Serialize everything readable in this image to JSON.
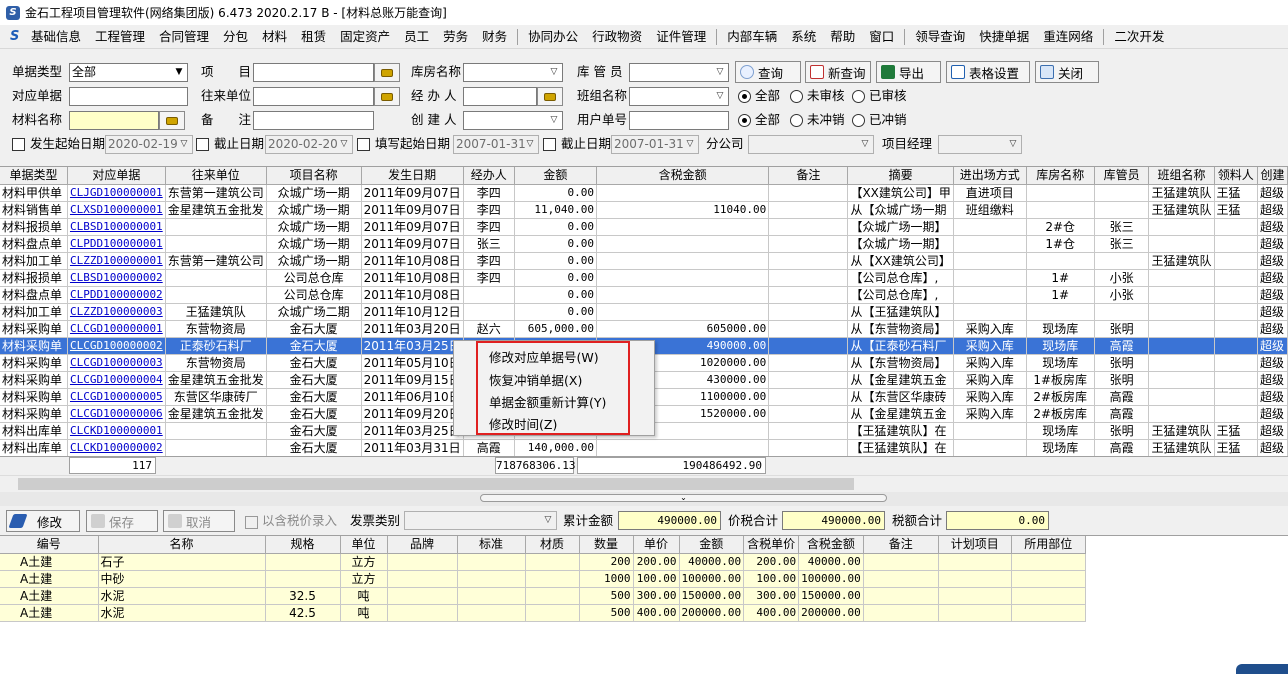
{
  "window": {
    "title": "金石工程项目管理软件(网络集团版) 6.473  2020.2.17 B - [材料总账万能查询]"
  },
  "menu": [
    "基础信息",
    "工程管理",
    "合同管理",
    "分包",
    "材料",
    "租赁",
    "固定资产",
    "员工",
    "劳务",
    "财务",
    "协同办公",
    "行政物资",
    "证件管理",
    "内部车辆",
    "系统",
    "帮助",
    "窗口",
    "领导查询",
    "快捷单据",
    "重连网络",
    "二次开发"
  ],
  "filter": {
    "doc_type_label": "单据类型",
    "doc_type_value": "全部",
    "project_label": "项　　目",
    "warehouse_label": "库房名称",
    "keeper_label": "库 管 员",
    "related_doc_label": "对应单据",
    "partner_label": "往来单位",
    "handler_label": "经 办 人",
    "team_label": "班组名称",
    "material_label": "材料名称",
    "remark_label": "备　　注",
    "creator_label": "创 建 人",
    "user_doc_label": "用户单号",
    "audit_all": "全部",
    "audit_no": "未审核",
    "audit_yes": "已审核",
    "offset_all": "全部",
    "offset_no": "未冲销",
    "offset_yes": "已冲销",
    "start_date_label": "发生起始日期",
    "start_date": "2020-02-19",
    "end_date_label": "截止日期",
    "end_date": "2020-02-20",
    "fill_start_label": "填写起始日期",
    "fill_start": "2007-01-31",
    "fill_end_label": "截止日期",
    "fill_end": "2007-01-31",
    "branch_label": "分公司",
    "pm_label": "项目经理"
  },
  "buttons": {
    "query": "查询",
    "new_query": "新查询",
    "export": "导出",
    "table_settings": "表格设置",
    "close": "关闭"
  },
  "grid": {
    "columns": [
      "单据类型",
      "对应单据",
      "往来单位",
      "项目名称",
      "发生日期",
      "经办人",
      "金额",
      "含税金额",
      "备注",
      "摘要",
      "进出场方式",
      "库房名称",
      "库管员",
      "班组名称",
      "领料人",
      "创建"
    ],
    "rows": [
      [
        "材料甲供单",
        "CLJGD100000001",
        "东营第一建筑公司",
        "众城广场一期",
        "2011年09月07日",
        "李四",
        "0.00",
        "",
        "",
        "【XX建筑公司】甲",
        "直进项目",
        "",
        "",
        "王猛建筑队",
        "王猛",
        "超级"
      ],
      [
        "材料销售单",
        "CLXSD100000001",
        "金星建筑五金批发",
        "众城广场一期",
        "2011年09月07日",
        "李四",
        "11,040.00",
        "11040.00",
        "",
        "从【众城广场一期",
        "班组缴料",
        "",
        "",
        "王猛建筑队",
        "王猛",
        "超级"
      ],
      [
        "材料报损单",
        "CLBSD100000001",
        "",
        "众城广场一期",
        "2011年09月07日",
        "李四",
        "0.00",
        "",
        "",
        "【众城广场一期】",
        "",
        "2#仓",
        "张三",
        "",
        "",
        "超级"
      ],
      [
        "材料盘点单",
        "CLPDD100000001",
        "",
        "众城广场一期",
        "2011年09月07日",
        "张三",
        "0.00",
        "",
        "",
        "【众城广场一期】",
        "",
        "1#仓",
        "张三",
        "",
        "",
        "超级"
      ],
      [
        "材料加工单",
        "CLZZD100000001",
        "东营第一建筑公司",
        "众城广场一期",
        "2011年10月08日",
        "李四",
        "0.00",
        "",
        "",
        "从【XX建筑公司】",
        "",
        "",
        "",
        "王猛建筑队",
        "",
        "超级"
      ],
      [
        "材料报损单",
        "CLBSD100000002",
        "",
        "公司总仓库",
        "2011年10月08日",
        "李四",
        "0.00",
        "",
        "",
        "【公司总仓库】,",
        "",
        "1#",
        "小张",
        "",
        "",
        "超级"
      ],
      [
        "材料盘点单",
        "CLPDD100000002",
        "",
        "公司总仓库",
        "2011年10月08日",
        "",
        "0.00",
        "",
        "",
        "【公司总仓库】,",
        "",
        "1#",
        "小张",
        "",
        "",
        "超级"
      ],
      [
        "材料加工单",
        "CLZZD100000003",
        "王猛建筑队",
        "众城广场二期",
        "2011年10月12日",
        "",
        "0.00",
        "",
        "",
        "从【王猛建筑队】",
        "",
        "",
        "",
        "",
        "",
        "超级"
      ],
      [
        "材料采购单",
        "CLCGD100000001",
        "东营物资局",
        "金石大厦",
        "2011年03月20日",
        "赵六",
        "605,000.00",
        "605000.00",
        "",
        "从【东营物资局】",
        "采购入库",
        "现场库",
        "张明",
        "",
        "",
        "超级"
      ],
      [
        "材料采购单",
        "CLCGD100000002",
        "正泰砂石料厂",
        "金石大厦",
        "2011年03月25日",
        "",
        "",
        "490000.00",
        "",
        "从【正泰砂石料厂",
        "采购入库",
        "现场库",
        "高霞",
        "",
        "",
        "超级"
      ],
      [
        "材料采购单",
        "CLCGD100000003",
        "东营物资局",
        "金石大厦",
        "2011年05月10日",
        "",
        "",
        "1020000.00",
        "",
        "从【东营物资局】",
        "采购入库",
        "现场库",
        "张明",
        "",
        "",
        "超级"
      ],
      [
        "材料采购单",
        "CLCGD100000004",
        "金星建筑五金批发",
        "金石大厦",
        "2011年09月15日",
        "",
        "",
        "430000.00",
        "",
        "从【金星建筑五金",
        "采购入库",
        "1#板房库",
        "张明",
        "",
        "",
        "超级"
      ],
      [
        "材料采购单",
        "CLCGD100000005",
        "东营区华康砖厂",
        "金石大厦",
        "2011年06月10日",
        "",
        "",
        "1100000.00",
        "",
        "从【东营区华康砖",
        "采购入库",
        "2#板房库",
        "高霞",
        "",
        "",
        "超级"
      ],
      [
        "材料采购单",
        "CLCGD100000006",
        "金星建筑五金批发",
        "金石大厦",
        "2011年09月20日",
        "",
        "",
        "1520000.00",
        "",
        "从【金星建筑五金",
        "采购入库",
        "2#板房库",
        "高霞",
        "",
        "",
        "超级"
      ],
      [
        "材料出库单",
        "CLCKD100000001",
        "",
        "金石大厦",
        "2011年03月25日",
        "",
        "",
        "",
        "",
        "【王猛建筑队】在",
        "",
        "现场库",
        "张明",
        "王猛建筑队",
        "王猛",
        "超级"
      ],
      [
        "材料出库单",
        "CLCKD100000002",
        "",
        "金石大厦",
        "2011年03月31日",
        "高霞",
        "140,000.00",
        "",
        "",
        "【王猛建筑队】在",
        "",
        "现场库",
        "高霞",
        "王猛建筑队",
        "王猛",
        "超级"
      ]
    ],
    "selected_index": 9,
    "sum_count": "117",
    "sum_amount": "718768306.13",
    "sum_tax_amount": "190486492.90"
  },
  "context_menu": [
    "修改对应单据号(W)",
    "恢复冲销单据(X)",
    "单据金额重新计算(Y)",
    "修改时间(Z)"
  ],
  "bottom_bar": {
    "edit": "修改",
    "save": "保存",
    "cancel": "取消",
    "tax_entry": "以含税价录入",
    "invoice_label": "发票类别",
    "total_label": "累计金额",
    "total": "490000.00",
    "price_tax_label": "价税合计",
    "price_tax": "490000.00",
    "tax_total_label": "税额合计",
    "tax_total": "0.00"
  },
  "detail": {
    "columns": [
      "编号",
      "名称",
      "规格",
      "单位",
      "品牌",
      "标准",
      "材质",
      "数量",
      "单价",
      "金额",
      "含税单价",
      "含税金额",
      "备注",
      "计划项目",
      "所用部位"
    ],
    "rows": [
      [
        "A土建",
        "石子",
        "",
        "立方",
        "",
        "",
        "",
        "200",
        "200.00",
        "40000.00",
        "200.00",
        "40000.00",
        "",
        "",
        ""
      ],
      [
        "A土建",
        "中砂",
        "",
        "立方",
        "",
        "",
        "",
        "1000",
        "100.00",
        "100000.00",
        "100.00",
        "100000.00",
        "",
        "",
        ""
      ],
      [
        "A土建",
        "水泥",
        "32.5",
        "吨",
        "",
        "",
        "",
        "500",
        "300.00",
        "150000.00",
        "300.00",
        "150000.00",
        "",
        "",
        ""
      ],
      [
        "A土建",
        "水泥",
        "42.5",
        "吨",
        "",
        "",
        "",
        "500",
        "400.00",
        "200000.00",
        "400.00",
        "200000.00",
        "",
        "",
        ""
      ]
    ]
  }
}
